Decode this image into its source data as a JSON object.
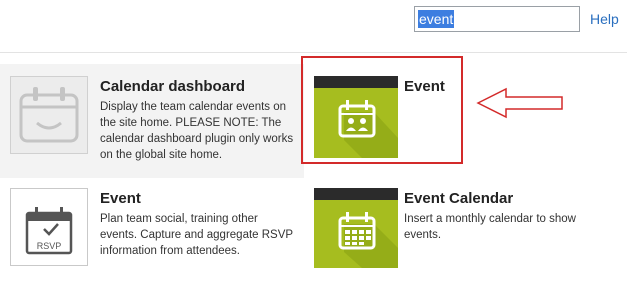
{
  "search": {
    "value": "event",
    "help_label": "Help"
  },
  "tiles": [
    {
      "title": "Calendar dashboard",
      "description": "Display the team calendar events on the site home. PLEASE NOTE: The calendar dashboard plugin only works on the global site home.",
      "icon": "calendar-check-icon"
    },
    {
      "title": "Event",
      "description": "",
      "icon": "calendar-people-icon"
    },
    {
      "title": "Event",
      "description": "Plan team social, training other events. Capture and aggregate RSVP information from attendees.",
      "icon": "calendar-rsvp-icon",
      "icon_text": "RSVP"
    },
    {
      "title": "Event Calendar",
      "description": "Insert a monthly calendar to show events.",
      "icon": "calendar-grid-icon"
    }
  ],
  "colors": {
    "accent_green": "#a6bd1f",
    "highlight_red": "#d32a2a",
    "link": "#2a6fbf"
  }
}
